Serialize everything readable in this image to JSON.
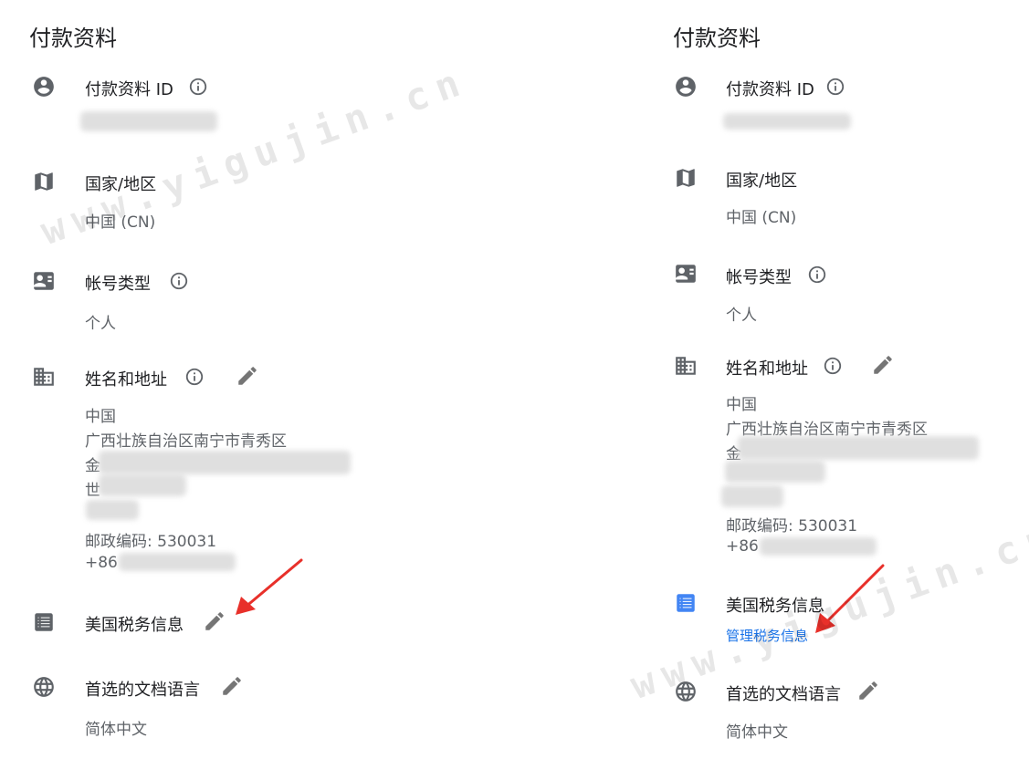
{
  "left": {
    "title": "付款资料",
    "profile_id_label": "付款资料 ID",
    "country_label": "国家/地区",
    "country_value": "中国 (CN)",
    "account_type_label": "帐号类型",
    "account_type_value": "个人",
    "name_address_label": "姓名和地址",
    "address_country": "中国",
    "address_region": "广西壮族自治区南宁市青秀区",
    "address_line3_prefix": "金",
    "address_line4_prefix": "世",
    "postal_code": "邮政编码: 530031",
    "phone_prefix": "+86",
    "us_tax_label": "美国税务信息",
    "doc_language_label": "首选的文档语言",
    "doc_language_value": "简体中文"
  },
  "right": {
    "title": "付款资料",
    "profile_id_label": "付款资料 ID",
    "country_label": "国家/地区",
    "country_value": "中国 (CN)",
    "account_type_label": "帐号类型",
    "account_type_value": "个人",
    "name_address_label": "姓名和地址",
    "address_country": "中国",
    "address_region": "广西壮族自治区南宁市青秀区",
    "address_line3_prefix": "金",
    "postal_code": "邮政编码: 530031",
    "phone_prefix": "+86",
    "us_tax_label": "美国税务信息",
    "manage_tax_link": "管理税务信息",
    "doc_language_label": "首选的文档语言",
    "doc_language_value": "简体中文"
  },
  "watermark_text": "www.yigujin.cn",
  "colors": {
    "icon_gray": "#5f6368",
    "icon_active_blue": "#4285f4",
    "link_blue": "#1a73e8",
    "arrow_red": "#e8302a"
  }
}
